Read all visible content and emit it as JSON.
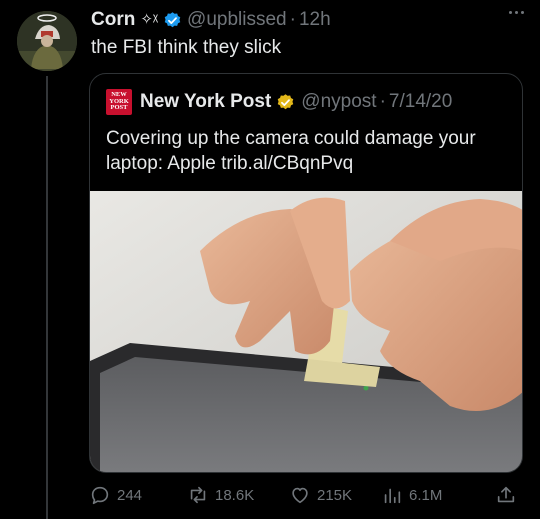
{
  "tweet": {
    "author_name": "Corn",
    "author_decoration": "✧ᵡ",
    "handle": "@upblissed",
    "separator": "·",
    "time": "12h",
    "text": "the FBI think they slick"
  },
  "quoted_tweet": {
    "logo_text": [
      "NEW",
      "YORK",
      "POST"
    ],
    "author_name": "New York Post",
    "handle": "@nypost",
    "separator": "·",
    "date": "7/14/20",
    "text": "Covering up the camera could damage your laptop: Apple trib.al/CBqnPvq"
  },
  "actions": {
    "replies": "244",
    "reposts": "18.6K",
    "likes": "215K",
    "views": "6.1M"
  },
  "colors": {
    "background": "#000000",
    "text": "#e7e9ea",
    "muted": "#71767b",
    "border": "#2f3336",
    "verified_blue": "#1d9bf0",
    "verified_gold": "#e2b719",
    "nyp_red": "#c8102e"
  },
  "icons": [
    "more-icon",
    "verified-blue-icon",
    "verified-gold-icon",
    "reply-icon",
    "repost-icon",
    "like-icon",
    "views-icon",
    "share-icon"
  ]
}
